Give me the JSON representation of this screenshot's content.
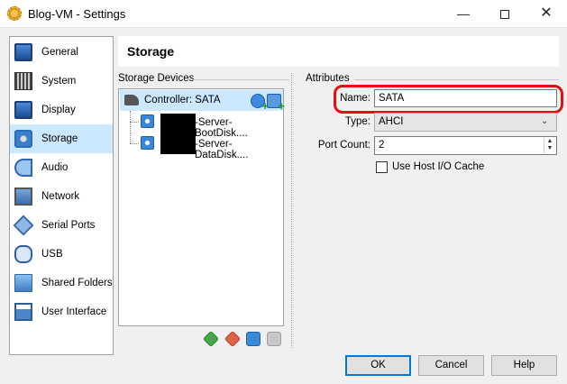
{
  "window": {
    "title": "Blog-VM - Settings",
    "minimize": "—",
    "close": "✕"
  },
  "nav": {
    "items": [
      {
        "label": "General",
        "icon": "monitor-icon"
      },
      {
        "label": "System",
        "icon": "chip-icon"
      },
      {
        "label": "Display",
        "icon": "display-icon"
      },
      {
        "label": "Storage",
        "icon": "storage-icon",
        "selected": true
      },
      {
        "label": "Audio",
        "icon": "audio-icon"
      },
      {
        "label": "Network",
        "icon": "network-icon"
      },
      {
        "label": "Serial Ports",
        "icon": "serial-port-icon"
      },
      {
        "label": "USB",
        "icon": "usb-icon"
      },
      {
        "label": "Shared Folders",
        "icon": "shared-folder-icon"
      },
      {
        "label": "User Interface",
        "icon": "user-interface-icon"
      }
    ]
  },
  "page": {
    "title": "Storage"
  },
  "storage_devices": {
    "heading": "Storage Devices",
    "controller": {
      "label": "Controller: SATA"
    },
    "disks": [
      {
        "label": "-Server-BootDisk...."
      },
      {
        "label": "-Server-DataDisk...."
      }
    ]
  },
  "attributes": {
    "heading": "Attributes",
    "name_label": "Name:",
    "name_value": "SATA",
    "type_label": "Type:",
    "type_value": "AHCI",
    "port_count_label": "Port Count:",
    "port_count_value": "2",
    "host_io_cache_label": "Use Host I/O Cache",
    "host_io_cache_checked": false,
    "highlight_color": "#e21010"
  },
  "buttons": {
    "ok": "OK",
    "cancel": "Cancel",
    "help": "Help"
  },
  "colors": {
    "selection": "#cce8ff",
    "accent": "#0078d7"
  }
}
